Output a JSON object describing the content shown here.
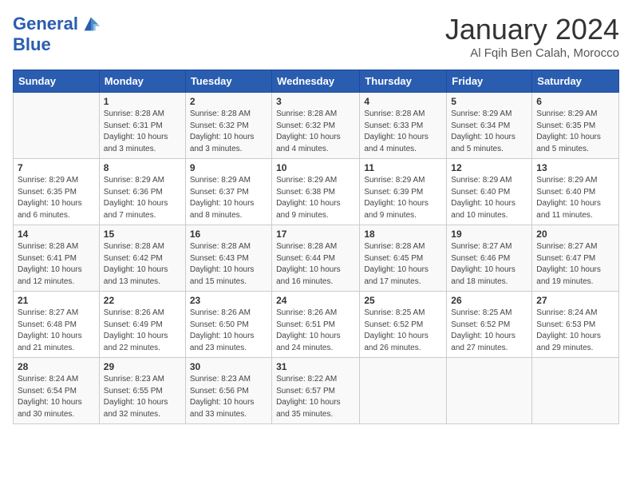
{
  "logo": {
    "line1": "General",
    "line2": "Blue"
  },
  "title": "January 2024",
  "location": "Al Fqih Ben Calah, Morocco",
  "headers": [
    "Sunday",
    "Monday",
    "Tuesday",
    "Wednesday",
    "Thursday",
    "Friday",
    "Saturday"
  ],
  "weeks": [
    [
      {
        "day": "",
        "sunrise": "",
        "sunset": "",
        "daylight": ""
      },
      {
        "day": "1",
        "sunrise": "Sunrise: 8:28 AM",
        "sunset": "Sunset: 6:31 PM",
        "daylight": "Daylight: 10 hours and 3 minutes."
      },
      {
        "day": "2",
        "sunrise": "Sunrise: 8:28 AM",
        "sunset": "Sunset: 6:32 PM",
        "daylight": "Daylight: 10 hours and 3 minutes."
      },
      {
        "day": "3",
        "sunrise": "Sunrise: 8:28 AM",
        "sunset": "Sunset: 6:32 PM",
        "daylight": "Daylight: 10 hours and 4 minutes."
      },
      {
        "day": "4",
        "sunrise": "Sunrise: 8:28 AM",
        "sunset": "Sunset: 6:33 PM",
        "daylight": "Daylight: 10 hours and 4 minutes."
      },
      {
        "day": "5",
        "sunrise": "Sunrise: 8:29 AM",
        "sunset": "Sunset: 6:34 PM",
        "daylight": "Daylight: 10 hours and 5 minutes."
      },
      {
        "day": "6",
        "sunrise": "Sunrise: 8:29 AM",
        "sunset": "Sunset: 6:35 PM",
        "daylight": "Daylight: 10 hours and 5 minutes."
      }
    ],
    [
      {
        "day": "7",
        "sunrise": "Sunrise: 8:29 AM",
        "sunset": "Sunset: 6:35 PM",
        "daylight": "Daylight: 10 hours and 6 minutes."
      },
      {
        "day": "8",
        "sunrise": "Sunrise: 8:29 AM",
        "sunset": "Sunset: 6:36 PM",
        "daylight": "Daylight: 10 hours and 7 minutes."
      },
      {
        "day": "9",
        "sunrise": "Sunrise: 8:29 AM",
        "sunset": "Sunset: 6:37 PM",
        "daylight": "Daylight: 10 hours and 8 minutes."
      },
      {
        "day": "10",
        "sunrise": "Sunrise: 8:29 AM",
        "sunset": "Sunset: 6:38 PM",
        "daylight": "Daylight: 10 hours and 9 minutes."
      },
      {
        "day": "11",
        "sunrise": "Sunrise: 8:29 AM",
        "sunset": "Sunset: 6:39 PM",
        "daylight": "Daylight: 10 hours and 9 minutes."
      },
      {
        "day": "12",
        "sunrise": "Sunrise: 8:29 AM",
        "sunset": "Sunset: 6:40 PM",
        "daylight": "Daylight: 10 hours and 10 minutes."
      },
      {
        "day": "13",
        "sunrise": "Sunrise: 8:29 AM",
        "sunset": "Sunset: 6:40 PM",
        "daylight": "Daylight: 10 hours and 11 minutes."
      }
    ],
    [
      {
        "day": "14",
        "sunrise": "Sunrise: 8:28 AM",
        "sunset": "Sunset: 6:41 PM",
        "daylight": "Daylight: 10 hours and 12 minutes."
      },
      {
        "day": "15",
        "sunrise": "Sunrise: 8:28 AM",
        "sunset": "Sunset: 6:42 PM",
        "daylight": "Daylight: 10 hours and 13 minutes."
      },
      {
        "day": "16",
        "sunrise": "Sunrise: 8:28 AM",
        "sunset": "Sunset: 6:43 PM",
        "daylight": "Daylight: 10 hours and 15 minutes."
      },
      {
        "day": "17",
        "sunrise": "Sunrise: 8:28 AM",
        "sunset": "Sunset: 6:44 PM",
        "daylight": "Daylight: 10 hours and 16 minutes."
      },
      {
        "day": "18",
        "sunrise": "Sunrise: 8:28 AM",
        "sunset": "Sunset: 6:45 PM",
        "daylight": "Daylight: 10 hours and 17 minutes."
      },
      {
        "day": "19",
        "sunrise": "Sunrise: 8:27 AM",
        "sunset": "Sunset: 6:46 PM",
        "daylight": "Daylight: 10 hours and 18 minutes."
      },
      {
        "day": "20",
        "sunrise": "Sunrise: 8:27 AM",
        "sunset": "Sunset: 6:47 PM",
        "daylight": "Daylight: 10 hours and 19 minutes."
      }
    ],
    [
      {
        "day": "21",
        "sunrise": "Sunrise: 8:27 AM",
        "sunset": "Sunset: 6:48 PM",
        "daylight": "Daylight: 10 hours and 21 minutes."
      },
      {
        "day": "22",
        "sunrise": "Sunrise: 8:26 AM",
        "sunset": "Sunset: 6:49 PM",
        "daylight": "Daylight: 10 hours and 22 minutes."
      },
      {
        "day": "23",
        "sunrise": "Sunrise: 8:26 AM",
        "sunset": "Sunset: 6:50 PM",
        "daylight": "Daylight: 10 hours and 23 minutes."
      },
      {
        "day": "24",
        "sunrise": "Sunrise: 8:26 AM",
        "sunset": "Sunset: 6:51 PM",
        "daylight": "Daylight: 10 hours and 24 minutes."
      },
      {
        "day": "25",
        "sunrise": "Sunrise: 8:25 AM",
        "sunset": "Sunset: 6:52 PM",
        "daylight": "Daylight: 10 hours and 26 minutes."
      },
      {
        "day": "26",
        "sunrise": "Sunrise: 8:25 AM",
        "sunset": "Sunset: 6:52 PM",
        "daylight": "Daylight: 10 hours and 27 minutes."
      },
      {
        "day": "27",
        "sunrise": "Sunrise: 8:24 AM",
        "sunset": "Sunset: 6:53 PM",
        "daylight": "Daylight: 10 hours and 29 minutes."
      }
    ],
    [
      {
        "day": "28",
        "sunrise": "Sunrise: 8:24 AM",
        "sunset": "Sunset: 6:54 PM",
        "daylight": "Daylight: 10 hours and 30 minutes."
      },
      {
        "day": "29",
        "sunrise": "Sunrise: 8:23 AM",
        "sunset": "Sunset: 6:55 PM",
        "daylight": "Daylight: 10 hours and 32 minutes."
      },
      {
        "day": "30",
        "sunrise": "Sunrise: 8:23 AM",
        "sunset": "Sunset: 6:56 PM",
        "daylight": "Daylight: 10 hours and 33 minutes."
      },
      {
        "day": "31",
        "sunrise": "Sunrise: 8:22 AM",
        "sunset": "Sunset: 6:57 PM",
        "daylight": "Daylight: 10 hours and 35 minutes."
      },
      {
        "day": "",
        "sunrise": "",
        "sunset": "",
        "daylight": ""
      },
      {
        "day": "",
        "sunrise": "",
        "sunset": "",
        "daylight": ""
      },
      {
        "day": "",
        "sunrise": "",
        "sunset": "",
        "daylight": ""
      }
    ]
  ]
}
